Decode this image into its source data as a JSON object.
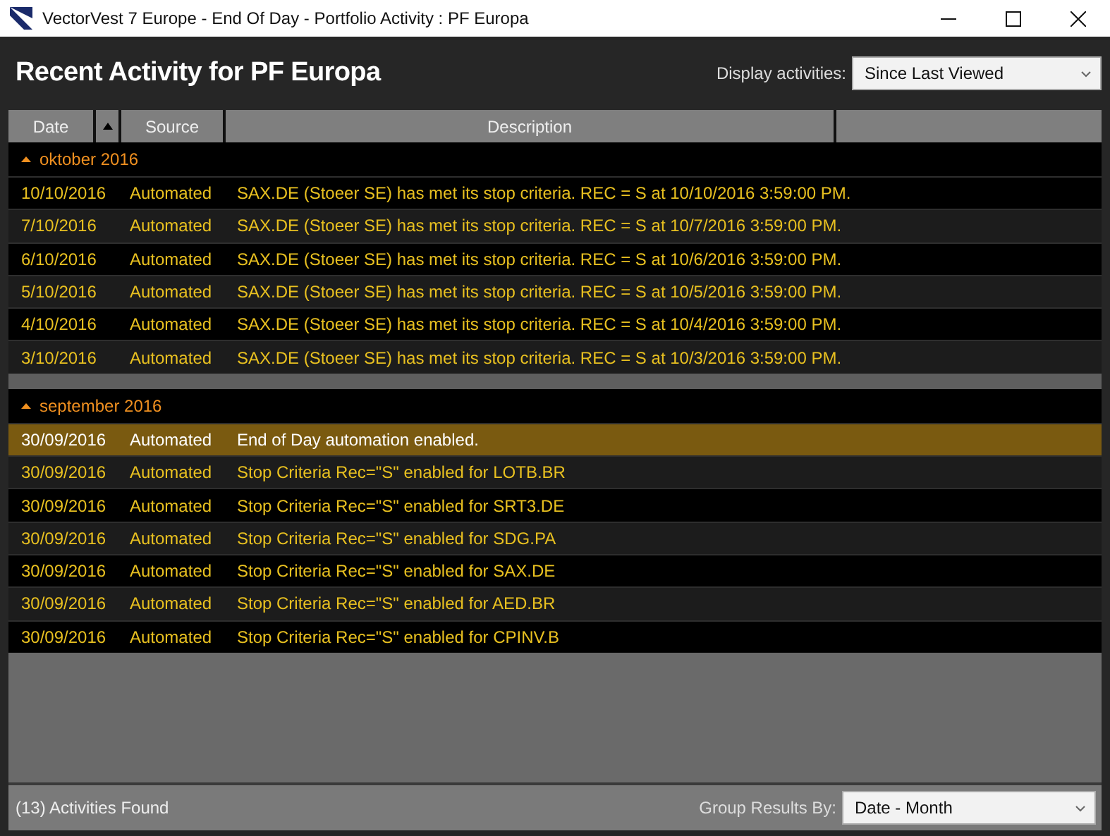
{
  "window": {
    "title": "VectorVest 7 Europe - End Of Day - Portfolio Activity : PF Europa"
  },
  "heading": "Recent Activity for PF Europa",
  "display_filter": {
    "label": "Display activities:",
    "value": "Since Last Viewed"
  },
  "table": {
    "columns": [
      {
        "label": "Date",
        "sorted": true
      },
      {
        "label": "Source"
      },
      {
        "label": "Description"
      }
    ],
    "groups": [
      {
        "label": "oktober 2016",
        "expanded": true,
        "rows": [
          {
            "date": "10/10/2016",
            "source": "Automated",
            "description": "SAX.DE (Stoeer SE) has met its stop criteria. REC = S at 10/10/2016 3:59:00 PM.",
            "selected": false
          },
          {
            "date": "7/10/2016",
            "source": "Automated",
            "description": "SAX.DE (Stoeer SE) has met its stop criteria. REC = S at 10/7/2016 3:59:00 PM.",
            "selected": false
          },
          {
            "date": "6/10/2016",
            "source": "Automated",
            "description": "SAX.DE (Stoeer SE) has met its stop criteria. REC = S at 10/6/2016 3:59:00 PM.",
            "selected": false
          },
          {
            "date": "5/10/2016",
            "source": "Automated",
            "description": "SAX.DE (Stoeer SE) has met its stop criteria. REC = S at 10/5/2016 3:59:00 PM.",
            "selected": false
          },
          {
            "date": "4/10/2016",
            "source": "Automated",
            "description": "SAX.DE (Stoeer SE) has met its stop criteria. REC = S at 10/4/2016 3:59:00 PM.",
            "selected": false
          },
          {
            "date": "3/10/2016",
            "source": "Automated",
            "description": "SAX.DE (Stoeer SE) has met its stop criteria. REC = S at 10/3/2016 3:59:00 PM.",
            "selected": false
          }
        ]
      },
      {
        "label": "september 2016",
        "expanded": true,
        "rows": [
          {
            "date": "30/09/2016",
            "source": "Automated",
            "description": "End of Day automation enabled.",
            "selected": true
          },
          {
            "date": "30/09/2016",
            "source": "Automated",
            "description": "Stop Criteria Rec=\"S\" enabled for LOTB.BR",
            "selected": false
          },
          {
            "date": "30/09/2016",
            "source": "Automated",
            "description": "Stop Criteria Rec=\"S\" enabled for SRT3.DE",
            "selected": false
          },
          {
            "date": "30/09/2016",
            "source": "Automated",
            "description": "Stop Criteria Rec=\"S\" enabled for SDG.PA",
            "selected": false
          },
          {
            "date": "30/09/2016",
            "source": "Automated",
            "description": "Stop Criteria Rec=\"S\" enabled for SAX.DE",
            "selected": false
          },
          {
            "date": "30/09/2016",
            "source": "Automated",
            "description": "Stop Criteria Rec=\"S\" enabled for AED.BR",
            "selected": false
          },
          {
            "date": "30/09/2016",
            "source": "Automated",
            "description": "Stop Criteria Rec=\"S\" enabled for CPINV.B",
            "selected": false
          }
        ]
      }
    ]
  },
  "status_bar": {
    "count": "(13) Activities Found",
    "group_label": "Group Results By:",
    "group_value": "Date - Month"
  }
}
